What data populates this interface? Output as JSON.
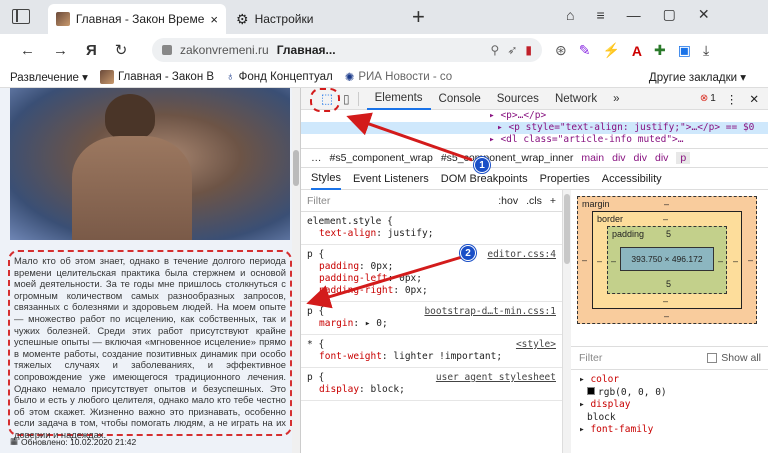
{
  "browser": {
    "tabs": [
      {
        "label": "Главная - Закон Времен"
      },
      {
        "label": "Настройки"
      }
    ],
    "new_tab": "+"
  },
  "address": {
    "logo": "Я",
    "domain": "zakonvremeni.ru",
    "title": "Главная..."
  },
  "bookmarks": {
    "items": [
      {
        "label": "Развлечение"
      },
      {
        "label": "Главная - Закон В"
      },
      {
        "label": "Фонд Концептуал"
      },
      {
        "label": "РИА Новости - со"
      }
    ],
    "other": "Другие закладки"
  },
  "article": {
    "text": "Мало кто об этом знает, однако в течение долгого периода времени целительская практика была стержнем и основой моей деятельности. За те годы мне пришлось столкнуться с огромным количеством самых разнообразных запросов, связанных с болезнями и здоровьем людей. На моем опыте — множество работ по исцелению, как собственных, так и чужих болезней. Среди этих работ присутствуют крайне успешные опыты — включая «мгновенное исцеление» прямо в моменте работы, создание позитивных динамик при особо тяжелых случаях и заболеваниях, и эффективное сопровождение уже имеющегося традиционного лечения. Однако немало присутствует опытов и безуспешных. Это было и есть у любого целителя, однако мало кто тебе честно об этом скажет. Жизненно важно это признавать, особенно если задача в том, чтобы помогать людям, а не играть на их доверии и надеждах.",
    "updated": "Обновлено: 10.02.2020 21:42"
  },
  "devtools": {
    "tabs": [
      {
        "label": "Elements"
      },
      {
        "label": "Console"
      },
      {
        "label": "Sources"
      },
      {
        "label": "Network"
      }
    ],
    "more": "»",
    "error_count": "1",
    "dom": [
      {
        "text": "<p>…</p>"
      },
      {
        "text": "<p style=\"text-align: justify;\">…</p> == $0"
      },
      {
        "text": "<dl class=\"article-info muted\">…"
      }
    ],
    "crumbs": [
      "…",
      "#s5_component_wrap",
      "#s5_component_wrap_inner",
      "main",
      "div",
      "div",
      "div",
      "p"
    ],
    "subtabs": [
      "Styles",
      "Event Listeners",
      "DOM Breakpoints",
      "Properties",
      "Accessibility"
    ],
    "filter": "Filter",
    "hov": ":hov",
    "cls": ".cls",
    "rules": [
      {
        "selector": "element.style {",
        "source": "",
        "props": [
          [
            "text-align",
            "justify"
          ]
        ]
      },
      {
        "selector": "p {",
        "source": "editor.css:4",
        "props": [
          [
            "padding",
            "0px"
          ],
          [
            "padding-left",
            "0px"
          ],
          [
            "padding-right",
            "0px"
          ]
        ]
      },
      {
        "selector": "p {",
        "source": "bootstrap-d…t-min.css:1",
        "props": [
          [
            "margin",
            "▸ 0"
          ]
        ]
      },
      {
        "selector": "* {",
        "source": "<style>",
        "props": [
          [
            "font-weight",
            "lighter !important"
          ]
        ]
      },
      {
        "selector": "p {",
        "source": "user agent stylesheet",
        "props": [
          [
            "display",
            "block"
          ]
        ]
      }
    ],
    "boxmodel": {
      "margin": "margin",
      "border": "border",
      "padding": "padding",
      "padding_val": "5",
      "content": "393.750 × 496.172",
      "dash": "–"
    },
    "computed": {
      "filter": "Filter",
      "show_all": "Show all",
      "props": [
        {
          "name": "color",
          "value": "rgb(0, 0, 0)"
        },
        {
          "name": "display",
          "value": "block"
        },
        {
          "name": "font-family",
          "value": ""
        }
      ]
    }
  },
  "annotations": [
    {
      "label": "1"
    },
    {
      "label": "2"
    }
  ],
  "colors": {
    "annotation": "#d31b1b",
    "marker": "#1a4fc7"
  }
}
